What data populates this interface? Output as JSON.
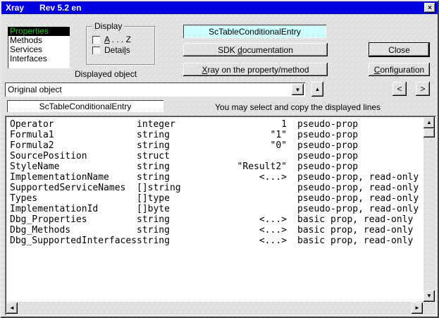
{
  "window": {
    "title": "Xray",
    "revision": "Rev 5.2 en",
    "close_glyph": "×"
  },
  "colors": {
    "titlebar": "#0000e0",
    "selected_item_bg": "#000000",
    "selected_item_fg": "#00c800",
    "object_name_bg": "#ccffff"
  },
  "categories": {
    "items": [
      {
        "label": "Properties",
        "selected": true
      },
      {
        "label": "Methods",
        "selected": false
      },
      {
        "label": "Services",
        "selected": false
      },
      {
        "label": "Interfaces",
        "selected": false
      }
    ]
  },
  "display_group": {
    "title": "Display",
    "az": {
      "pre": "",
      "key": "A",
      "post": " . . . Z",
      "checked": false
    },
    "details": {
      "pre": "Detai",
      "key": "l",
      "post": "s",
      "checked": false
    }
  },
  "labels": {
    "displayed_object": "Displayed object",
    "hint": "You may select and copy the displayed lines"
  },
  "object_name": "ScTableConditionalEntry",
  "object_name_copy": "ScTableConditionalEntry",
  "combo": {
    "value": "Original object"
  },
  "buttons": {
    "sdk": {
      "pre": "SDK ",
      "key": "d",
      "post": "ocumentation"
    },
    "xray": {
      "pre": "",
      "key": "X",
      "post": "ray on the property/method"
    },
    "close": "Close",
    "configuration": {
      "pre": "",
      "key": "C",
      "post": "onfiguration"
    },
    "prev": "<",
    "next": ">"
  },
  "icons": {
    "dropdown": "▼",
    "history_up": "▲",
    "scroll_up": "▲",
    "scroll_down": "▼",
    "scroll_left": "◄",
    "scroll_right": "►"
  },
  "table": {
    "rows": [
      {
        "name": "Operator",
        "type": "integer",
        "value": "1",
        "flags": "pseudo-prop"
      },
      {
        "name": "Formula1",
        "type": "string",
        "value": "\"1\"",
        "flags": "pseudo-prop"
      },
      {
        "name": "Formula2",
        "type": "string",
        "value": "\"0\"",
        "flags": "pseudo-prop"
      },
      {
        "name": "SourcePosition",
        "type": "struct",
        "value": "",
        "flags": "pseudo-prop"
      },
      {
        "name": "StyleName",
        "type": "string",
        "value": "\"Result2\"",
        "flags": "pseudo-prop"
      },
      {
        "name": "ImplementationName",
        "type": "string",
        "value": "<...>",
        "flags": "pseudo-prop, read-only"
      },
      {
        "name": "SupportedServiceNames",
        "type": "[]string",
        "value": "",
        "flags": "pseudo-prop, read-only"
      },
      {
        "name": "Types",
        "type": "[]type",
        "value": "",
        "flags": "pseudo-prop, read-only"
      },
      {
        "name": "ImplementationId",
        "type": "[]byte",
        "value": "",
        "flags": "pseudo-prop, read-only"
      },
      {
        "name": "Dbg_Properties",
        "type": "string",
        "value": "<...>",
        "flags": "basic prop, read-only"
      },
      {
        "name": "Dbg_Methods",
        "type": "string",
        "value": "<...>",
        "flags": "basic prop, read-only"
      },
      {
        "name": "Dbg_SupportedInterfaces",
        "type": "string",
        "value": "<...>",
        "flags": "basic prop, read-only"
      }
    ]
  }
}
